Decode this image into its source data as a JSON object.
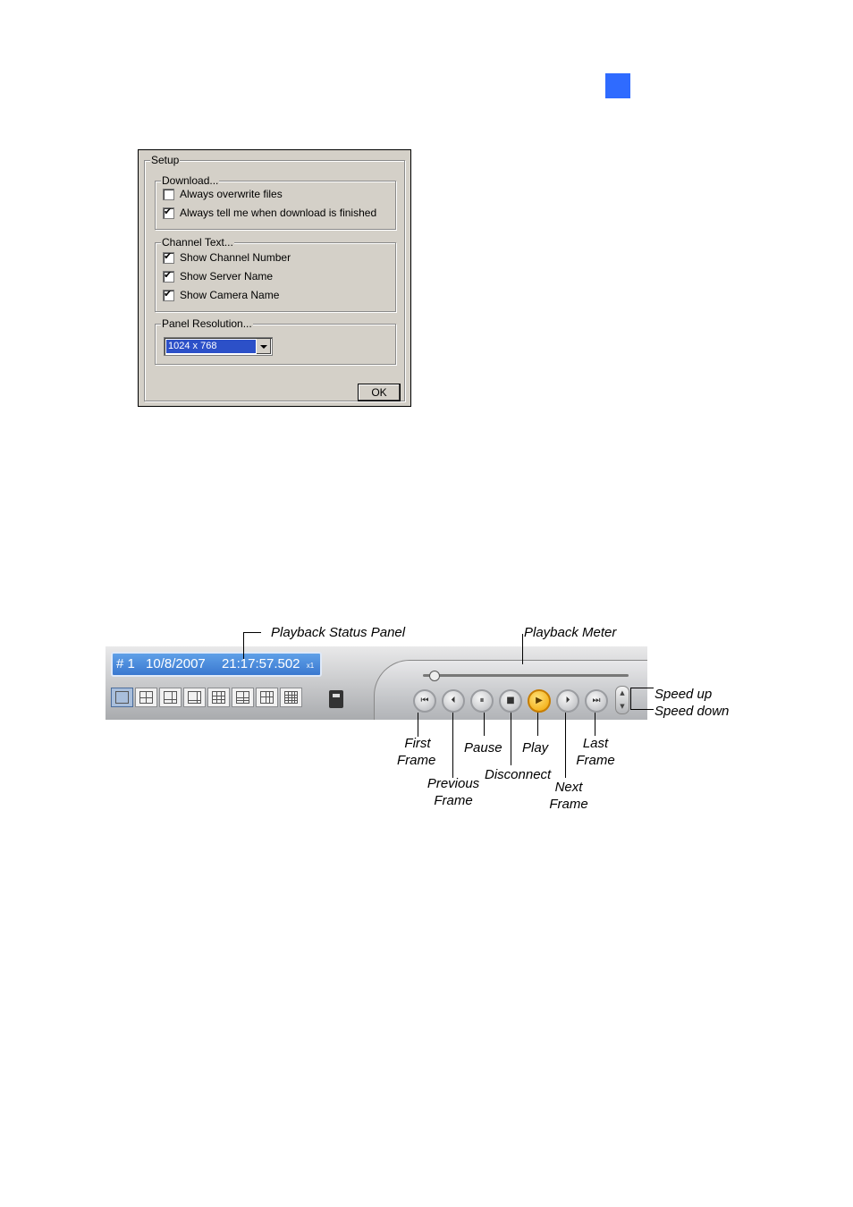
{
  "setup_dialog": {
    "title": "Setup",
    "download": {
      "label": "Download...",
      "options": [
        {
          "label": "Always overwrite files",
          "checked": false
        },
        {
          "label": "Always tell me when download is finished",
          "checked": true
        }
      ]
    },
    "channel_text": {
      "label": "Channel Text...",
      "options": [
        {
          "label": "Show Channel Number",
          "checked": true
        },
        {
          "label": "Show Server Name",
          "checked": true
        },
        {
          "label": "Show Camera Name",
          "checked": true
        }
      ]
    },
    "panel_resolution": {
      "label": "Panel Resolution...",
      "selected": "1024 x 768"
    },
    "ok_label": "OK"
  },
  "playback": {
    "status": {
      "channel": "# 1",
      "date": "10/8/2007",
      "time": "21:17:57.502",
      "speed": "x1"
    },
    "meter_position": 0.03,
    "callouts": {
      "status_panel": "Playback Status Panel",
      "meter": "Playback Meter",
      "speed_up": "Speed up",
      "speed_down": "Speed down",
      "first_frame": [
        "First",
        "Frame"
      ],
      "previous_frame": [
        "Previous",
        "Frame"
      ],
      "pause": "Pause",
      "disconnect": "Disconnect",
      "play": "Play",
      "next_frame": [
        "Next",
        "Frame"
      ],
      "last_frame": [
        "Last",
        "Frame"
      ]
    }
  },
  "colors": {
    "accent_square": "#2f6bff",
    "status_panel": "#4a8ad8",
    "play_button": "#f0a300",
    "selection": "#2c50c8"
  }
}
